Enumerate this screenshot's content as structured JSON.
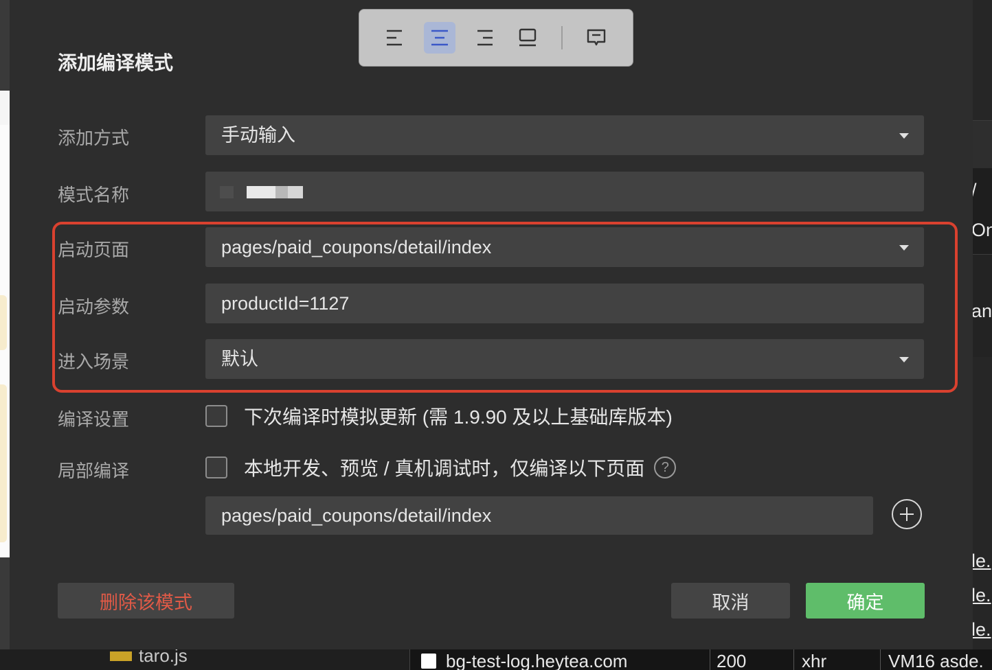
{
  "modal": {
    "title": "添加编译模式"
  },
  "toolbar": {
    "buttons": [
      {
        "icon": "align-left-icon",
        "active": false
      },
      {
        "icon": "align-center-icon",
        "active": true
      },
      {
        "icon": "align-right-icon",
        "active": false
      },
      {
        "icon": "device-preview-icon",
        "active": false
      },
      {
        "icon": "comment-icon",
        "active": false
      }
    ]
  },
  "form": {
    "add_method": {
      "label": "添加方式",
      "value": "手动输入"
    },
    "mode_name": {
      "label": "模式名称",
      "value": ""
    },
    "launch_page": {
      "label": "启动页面",
      "value": "pages/paid_coupons/detail/index"
    },
    "launch_params": {
      "label": "启动参数",
      "value": "productId=1127"
    },
    "scene": {
      "label": "进入场景",
      "value": "默认"
    },
    "compile_settings": {
      "label": "编译设置",
      "checkbox_text": "下次编译时模拟更新 (需 1.9.90 及以上基础库版本)",
      "checked": false
    },
    "partial_compile": {
      "label": "局部编译",
      "checkbox_text": "本地开发、预览 / 真机调试时，仅编译以下页面",
      "checked": false,
      "help": "?"
    },
    "partial_page": {
      "value": "pages/paid_coupons/detail/index"
    }
  },
  "buttons": {
    "delete": "删除该模式",
    "cancel": "取消",
    "ok": "确定"
  },
  "background": {
    "right_fragments": [
      "/",
      "Onl",
      "ani",
      "le.",
      "le.",
      "le."
    ],
    "file_name": "taro.js",
    "network_row": {
      "name": "bg-test-log.heytea.com",
      "status": "200",
      "type": "xhr",
      "initiator": "VM16 asde."
    }
  },
  "colors": {
    "highlight": "#d9412f",
    "ok_button": "#5fbd6a",
    "delete_text": "#e05a47",
    "active_tool": "#aab7d6"
  }
}
